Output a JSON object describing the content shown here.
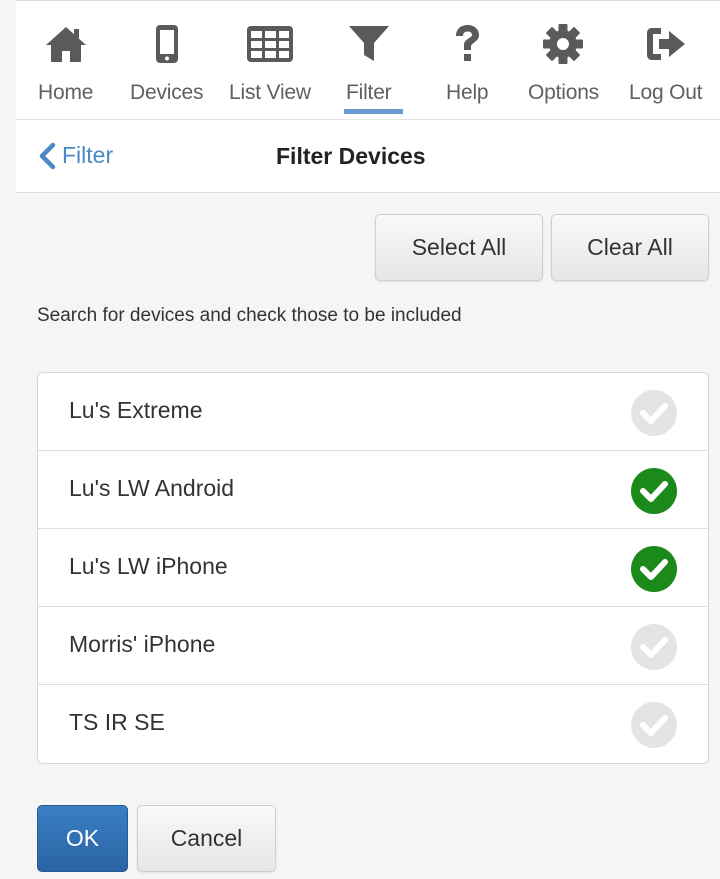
{
  "nav": {
    "items": [
      {
        "label": "Home",
        "icon": "home-icon"
      },
      {
        "label": "Devices",
        "icon": "phone-icon"
      },
      {
        "label": "List View",
        "icon": "grid-icon"
      },
      {
        "label": "Filter",
        "icon": "filter-icon",
        "active": true
      },
      {
        "label": "Help",
        "icon": "question-icon"
      },
      {
        "label": "Options",
        "icon": "gear-icon"
      },
      {
        "label": "Log Out",
        "icon": "logout-icon"
      }
    ]
  },
  "header": {
    "back_label": "Filter",
    "title": "Filter Devices"
  },
  "actions": {
    "select_all": "Select All",
    "clear_all": "Clear All"
  },
  "instructions": "Search for devices and check those to be included",
  "devices": [
    {
      "name": "Lu's Extreme",
      "checked": false
    },
    {
      "name": "Lu's LW Android",
      "checked": true
    },
    {
      "name": "Lu's LW iPhone",
      "checked": true
    },
    {
      "name": "Morris' iPhone",
      "checked": false
    },
    {
      "name": "TS IR SE",
      "checked": false
    }
  ],
  "footer": {
    "ok": "OK",
    "cancel": "Cancel"
  },
  "colors": {
    "icon": "#5a5a5a",
    "accent": "#4a88c6",
    "check_on": "#1b8a1b",
    "check_off": "#e4e4e4",
    "primary_button": "#2f6fb3"
  }
}
